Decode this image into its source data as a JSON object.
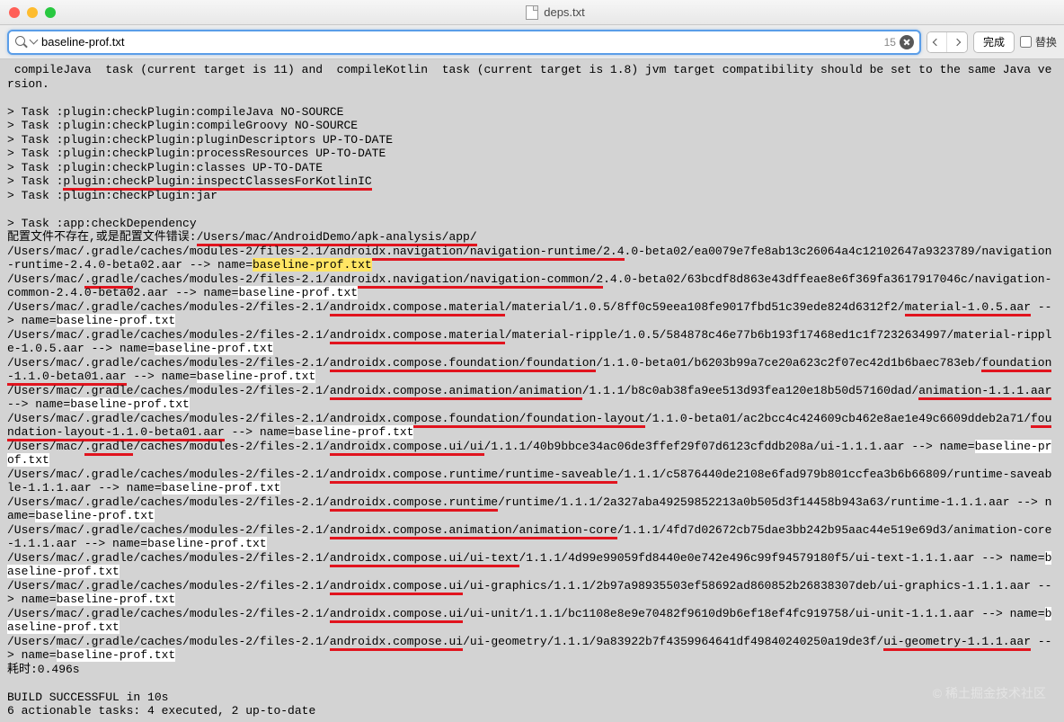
{
  "window": {
    "title": "deps.txt"
  },
  "search": {
    "value": "baseline-prof.txt",
    "count": "15",
    "done": "完成",
    "replace": "替换"
  },
  "topLine": " compileJava  task (current target is 11) and  compileKotlin  task (current target is 1.8) jvm target compatibility should be set to the same Java version.",
  "tasks": [
    "> Task :plugin:checkPlugin:compileJava NO-SOURCE",
    "> Task :plugin:checkPlugin:compileGroovy NO-SOURCE",
    "> Task :plugin:checkPlugin:pluginDescriptors UP-TO-DATE",
    "> Task :plugin:checkPlugin:processResources UP-TO-DATE",
    "> Task :plugin:checkPlugin:classes UP-TO-DATE"
  ],
  "taskInspectPre": "> Task :",
  "taskInspectU": "plugin:checkPlugin:inspectClassesForKotlinIC",
  "taskJar": "> Task :plugin:checkPlugin:jar",
  "taskDep": "> Task :app:checkDependency",
  "cfg": {
    "label": "配置文件不存在,或是配置文件错误:",
    "path": "/Users/mac/AndroidDemo/apk-analysis/app/"
  },
  "e1": {
    "pre": "/Users/mac/.gradle/caches/modules-2/files-2.1/",
    "u": "androidx.navigation/navigation-runtime/2.4",
    "post": ".0-beta02/ea0079e7fe8ab13c26064a4c12102647a9323789/navigation-runtime-2.4.0-beta02.aar --> name=",
    "match": "baseline-prof.txt"
  },
  "e2": {
    "pre": "/Users/mac/",
    "g": ".gradle",
    "mid": "/caches/modules-2/files-2.1/",
    "u": "androidx.navigation/navigation-common/2",
    "post": ".4.0-beta02/63bcdf8d863e43dffeae8e6f369fa3617917046c/navigation-common-2.4.0-beta02.aar --> name=",
    "match": "baseline-prof.txt"
  },
  "e3": {
    "pre": "/Users/mac/.gradle/caches/modules-2/files-2.1/",
    "u": "androidx.compose.material",
    "post": "/material/1.0.5/8ff0c59eea108fe9017fbd51c39ede824d6312f2/",
    "u2": "material-1.0.5.aar",
    "tail": " --> name=",
    "match": "baseline-prof.txt"
  },
  "e4": {
    "pre": "/Users/mac/.gradle/caches/modules-2/files-2.1/",
    "u": "androidx.compose.material",
    "post": "/material-ripple/1.0.5/584878c46e77b6b193f17468ed1c1f7232634997/material-ripple-1.0.5.aar --> name=",
    "match": "baseline-prof.txt"
  },
  "e5": {
    "pre": "/Users/mac/.gradle/caches/modules-2/files-2.1/",
    "u": "androidx.compose.foundation/foundation",
    "post": "/1.1.0-beta01/b6203b99a7ce20a623c2f07ec42d1b6baec783eb/",
    "u2": "foundation-1.1.0-beta01.aar",
    "tail": " --> name=",
    "match": "baseline-prof.txt"
  },
  "e6": {
    "pre": "/Users/mac/.gradle/caches/modules-2/files-2.1/",
    "u": "androidx.compose.animation/animation",
    "post": "/1.1.1/b8c0ab38fa9ee513d93fea120e18b50d57160dad/",
    "u2": "animation-1.1.1.aar",
    "tail": " --> name=",
    "match": "baseline-prof.txt"
  },
  "e7": {
    "pre": "/Users/mac/.gradle/caches/modules-2/files-2.1/",
    "u": "androidx.compose.foundation/foundation-layout",
    "post": "/1.1.0-beta01/ac2bcc4c424609cb462e8ae1e49c6609ddeb2a71/",
    "u2": "foundation-layout-1.1.0-beta01.aar",
    "tail": " --> name=",
    "match": "baseline-prof.txt"
  },
  "e8": {
    "pre": "/Users/mac/",
    "g": ".gradle",
    "mid": "/caches/modules-2/files-2.1/",
    "u": "androidx.compose.ui/ui",
    "post": "/1.1.1/40b9bbce34ac06de3ffef29f07d6123cfddb208a/ui-1.1.1.aar --> name=",
    "match": "baseline-prof.txt"
  },
  "e9": {
    "pre": "/Users/mac/.gradle/caches/modules-2/files-2.1/",
    "u": "androidx.compose.runtime/runtime-saveable",
    "post": "/1.1.1/c5876440de2108e6fad979b801ccfea3b6b66809/runtime-saveable-1.1.1.aar --> name=",
    "match": "baseline-prof.txt"
  },
  "e10": {
    "pre": "/Users/mac/.gradle/caches/modules-2/files-2.1/",
    "u": "androidx.compose.runtime",
    "post": "/runtime/1.1.1/2a327aba49259852213a0b505d3f14458b943a63/runtime-1.1.1.aar --> name=",
    "match": "baseline-prof.txt"
  },
  "e11": {
    "pre": "/Users/mac/.gradle/caches/modules-2/files-2.1/",
    "u": "androidx.compose.animation/animation-core",
    "post": "/1.1.1/4fd7d02672cb75dae3bb242b95aac44e519e69d3/animation-core-1.1.1.aar --> name=",
    "match": "baseline-prof.txt"
  },
  "e12": {
    "pre": "/Users/mac/.gradle/caches/modules-2/files-2.1/",
    "u": "androidx.compose.ui/ui-text",
    "post": "/1.1.1/4d99e99059fd8440e0e742e496c99f94579180f5/ui-text-1.1.1.aar --> name=",
    "match": "baseline-prof.txt"
  },
  "e13": {
    "pre": "/Users/mac/.gradle/caches/modules-2/files-2.1/",
    "u": "androidx.compose.ui",
    "post": "/ui-graphics/1.1.1/2b97a98935503ef58692ad860852b26838307deb/ui-graphics-1.1.1.aar --> name=",
    "match": "baseline-prof.txt"
  },
  "e14": {
    "pre": "/Users/mac/.gradle/caches/modules-2/files-2.1/",
    "u": "androidx.compose.ui",
    "post": "/ui-unit/1.1.1/bc1108e8e9e70482f9610d9b6ef18ef4fc919758/ui-unit-1.1.1.aar --> name=",
    "match": "baseline-prof.txt"
  },
  "e15": {
    "pre": "/Users/mac/",
    "g": ".gradle",
    "mid": "/caches/modules-2/files-2.1/",
    "u": "androidx.compose.ui",
    "post": "/ui-geometry/1.1.1/9a83922b7f4359964641df49840240250a19de3f/",
    "u2": "ui-geometry-1.1.1.aar",
    "tail": " --> name=",
    "match": "baseline-prof.txt"
  },
  "time": "耗时:0.496s",
  "build": "BUILD SUCCESSFUL in 10s",
  "actionable": "6 actionable tasks: 4 executed, 2 up-to-date",
  "watermark": "© 稀土掘金技术社区"
}
